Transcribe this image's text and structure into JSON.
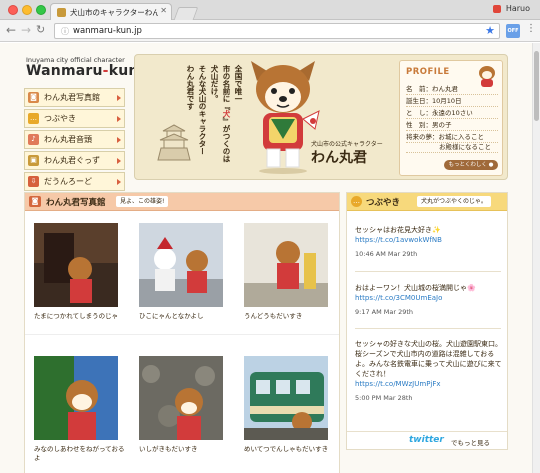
{
  "browser": {
    "tab_title": "犬山市のキャラクターわん丸君公式",
    "user_name": "Haruo",
    "url": "wanmaru-kun.jp",
    "extension_label": "OFF"
  },
  "brand": {
    "subtitle": "Inuyama city official character",
    "logo_main": "Wanmaru",
    "logo_dash": "-",
    "logo_kun": "kun"
  },
  "menu": [
    {
      "label": "わん丸君写真館",
      "icon": "camera-icon"
    },
    {
      "label": "つぶやき",
      "icon": "speech-bubble-icon"
    },
    {
      "label": "わん丸君音頭",
      "icon": "music-note-icon"
    },
    {
      "label": "わん丸君ぐっず",
      "icon": "bag-icon"
    },
    {
      "label": "だうんろーど",
      "icon": "download-icon"
    }
  ],
  "hero": {
    "vertical_lines": [
      "全国で唯一",
      "市の名前に『犬』がつくのは",
      "犬山だけ。",
      "そんな犬山のキャラクター",
      "わん丸君です"
    ],
    "sub_caption": "犬山市の公式キャラクター",
    "name": "わん丸君"
  },
  "profile": {
    "title": "PROFILE",
    "rows": [
      {
        "key": "名　前：",
        "value": "わん丸君"
      },
      {
        "key": "誕生日：",
        "value": "10月10日"
      },
      {
        "key": "と　し：",
        "value": "永遠の10さい"
      },
      {
        "key": "性　別：",
        "value": "男の子"
      },
      {
        "key": "将来の夢：",
        "value": "お城に入ること"
      },
      {
        "key": "",
        "value": "お殿様になること"
      }
    ],
    "more_label": "もっとくわしく ●"
  },
  "gallery": {
    "title": "わん丸君写真館",
    "tag": "見よ、この雄姿!",
    "photos": [
      {
        "caption": "たまにつかれてしまうのじゃ"
      },
      {
        "caption": "ひこにゃんとなかよし"
      },
      {
        "caption": "うんどうもだいすき"
      },
      {
        "caption": "みなのしあわせをねがっておるよ"
      },
      {
        "caption": "いしがきもだいすき"
      },
      {
        "caption": "めいてつでんしゃもだいすき"
      }
    ]
  },
  "tweets": {
    "title": "つぶやき",
    "tag": "犬丸がつぶやくのじゃ。",
    "items": [
      {
        "text": "セッシャはお花見大好き✨",
        "link": "https://t.co/1avwokWfNB",
        "time": "10:46 AM Mar 29th"
      },
      {
        "text": "おはよーワン！犬山城の桜満開じゃ🌸",
        "link": "https://t.co/3CM0UmEaJo",
        "time": "9:17 AM Mar 29th"
      },
      {
        "text": "セッシャの好きな犬山の桜。犬山遊園駅東口。桜シーズンで犬山市内の道路は混雑しておるよ。みんな名鉄電車に乗って犬山に遊びに来てくだされ！",
        "link": "https://t.co/MWzJUmPjFx",
        "time": "5:00 PM Mar 28th"
      }
    ],
    "brand": "twitter",
    "more": "でもっと見る"
  },
  "colors": {
    "accent_red": "#d23b3b",
    "menu_bg": "#fff6d9",
    "gallery_header": "#f6c9a8",
    "tweet_header": "#f7d97c",
    "twitter_blue": "#2fa7e0"
  }
}
